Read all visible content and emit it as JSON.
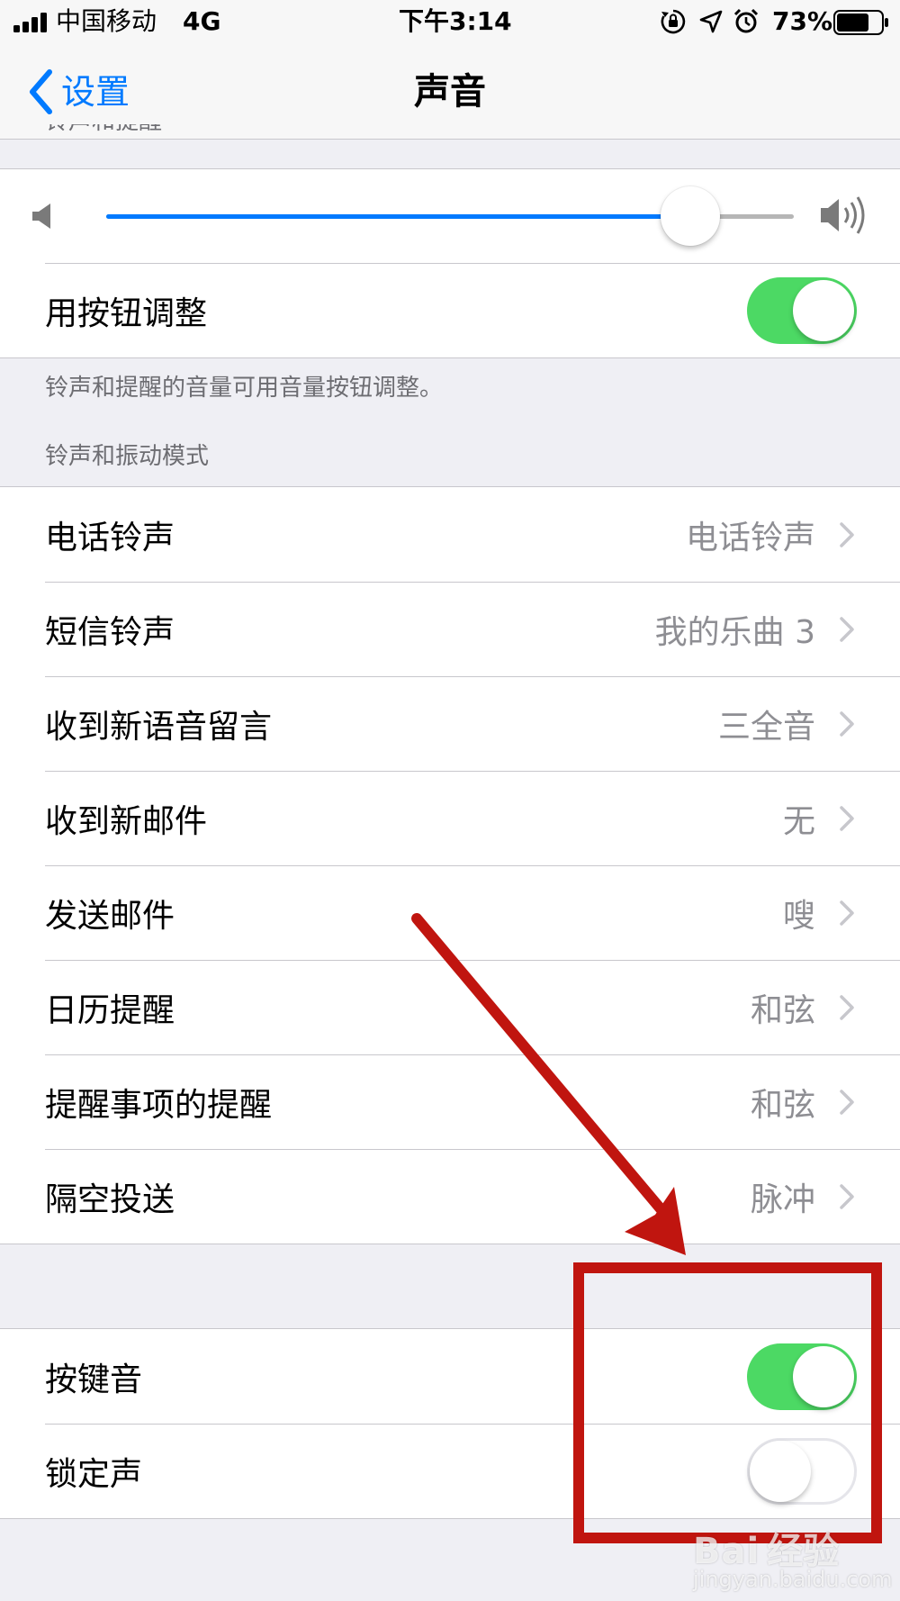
{
  "status_bar": {
    "carrier": "中国移动",
    "network": "4G",
    "time": "下午3:14",
    "battery_percent": "73%",
    "battery_level": 0.73,
    "icons": [
      "signal-icon",
      "lock-rotation-icon",
      "location-icon",
      "alarm-icon",
      "battery-icon"
    ]
  },
  "nav": {
    "back_label": "设置",
    "title": "声音"
  },
  "ringer_section": {
    "header": "铃声和提醒",
    "volume_level": 0.85,
    "adjust_with_buttons_label": "用按钮调整",
    "adjust_with_buttons_on": true,
    "footer": "铃声和提醒的音量可用音量按钮调整。"
  },
  "sounds_section": {
    "header": "铃声和振动模式",
    "rows": [
      {
        "label": "电话铃声",
        "value": "电话铃声"
      },
      {
        "label": "短信铃声",
        "value": "我的乐曲 3"
      },
      {
        "label": "收到新语音留言",
        "value": "三全音"
      },
      {
        "label": "收到新邮件",
        "value": "无"
      },
      {
        "label": "发送邮件",
        "value": "嗖"
      },
      {
        "label": "日历提醒",
        "value": "和弦"
      },
      {
        "label": "提醒事项的提醒",
        "value": "和弦"
      },
      {
        "label": "隔空投送",
        "value": "脉冲"
      }
    ]
  },
  "toggles_section": {
    "keyboard_clicks_label": "按键音",
    "keyboard_clicks_on": true,
    "lock_sound_label": "锁定声",
    "lock_sound_on": false
  },
  "annotation": {
    "color": "#c0150f"
  },
  "watermark": {
    "brand": "Bai",
    "sub": "经验",
    "url": "jingyan.baidu.com"
  },
  "colors": {
    "accent": "#007aff",
    "toggle_on": "#4cd964",
    "background": "#efeff4"
  }
}
